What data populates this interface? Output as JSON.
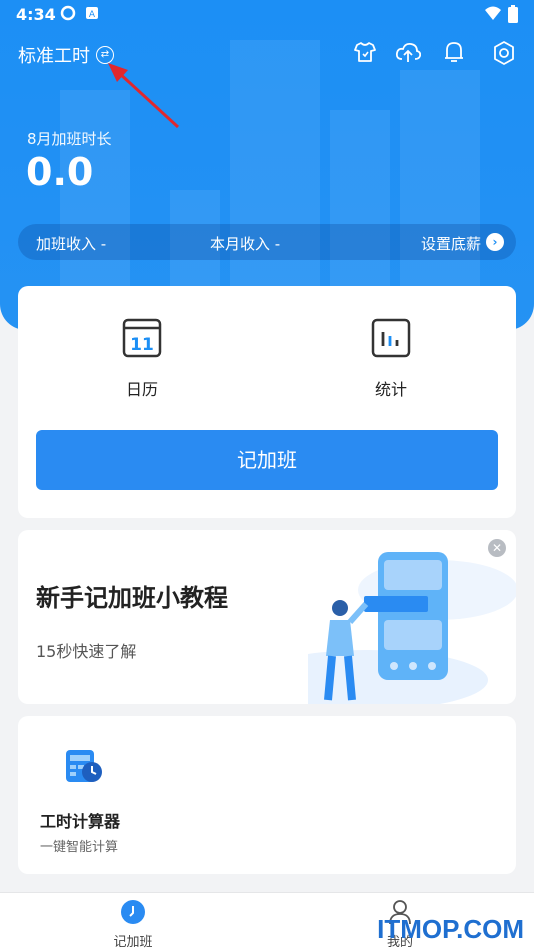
{
  "status_bar": {
    "time": "4:34"
  },
  "header": {
    "mode_label": "标准工时",
    "icons": [
      "shirt-icon",
      "cloud-upload-icon",
      "bell-icon",
      "settings-icon"
    ]
  },
  "summary": {
    "month_label": "8月加班时长",
    "hours": "0.0",
    "overtime_income": "加班收入 -",
    "month_income": "本月收入 -",
    "set_salary": "设置底薪"
  },
  "features": [
    {
      "label": "日历",
      "icon": "calendar-icon",
      "calendar_day": "11"
    },
    {
      "label": "统计",
      "icon": "stats-icon"
    }
  ],
  "record_button": "记加班",
  "tutorial": {
    "title": "新手记加班小教程",
    "subtitle": "15秒快速了解"
  },
  "tool": {
    "title": "工时计算器",
    "subtitle": "一键智能计算"
  },
  "bottom_nav": [
    {
      "label": "记加班",
      "active": true
    },
    {
      "label": "我的",
      "active": false
    }
  ],
  "watermark": "ITMOP.COM",
  "colors": {
    "primary": "#1c8ff5",
    "button": "#2a8bf2",
    "annotation_arrow": "#e0282e"
  }
}
